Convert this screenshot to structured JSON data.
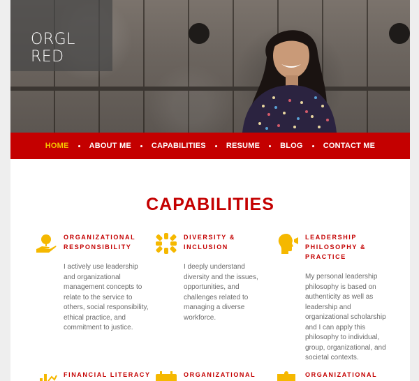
{
  "site": {
    "logo_text": "ORGL RED"
  },
  "nav": {
    "items": [
      {
        "label": "HOME",
        "active": true
      },
      {
        "label": "ABOUT ME",
        "active": false
      },
      {
        "label": "CAPABILITIES",
        "active": false
      },
      {
        "label": "RESUME",
        "active": false
      },
      {
        "label": "BLOG",
        "active": false
      },
      {
        "label": "CONTACT ME",
        "active": false
      }
    ]
  },
  "page": {
    "heading": "CAPABILITIES"
  },
  "capabilities": [
    {
      "icon": "hand-plant-icon",
      "title": "ORGANIZATIONAL RESPONSIBILITY",
      "description": "I actively use leadership and organizational management concepts to relate to the service to others, social responsibility, ethical practice, and commitment to justice."
    },
    {
      "icon": "diversity-hands-icon",
      "title": "DIVERSITY & INCLUSION",
      "description": "I deeply understand diversity and the issues, opportunities, and challenges related to managing a diverse workforce."
    },
    {
      "icon": "head-speaking-icon",
      "title": "LEADERSHIP PHILOSOPHY & PRACTICE",
      "description": "My personal leadership philosophy is based on authenticity as well as leadership and organizational scholarship and I can apply this philosophy to individual, group, organizational, and societal contexts."
    },
    {
      "icon": "bar-chart-icon",
      "title": "FINANCIAL LITERACY"
    },
    {
      "icon": "calendar-icon",
      "title": "ORGANIZATIONAL"
    },
    {
      "icon": "puzzle-icon",
      "title": "ORGANIZATIONAL"
    }
  ],
  "colors": {
    "brand_red": "#c40000",
    "accent_yellow": "#f5b800",
    "nav_active": "#f5c400"
  }
}
